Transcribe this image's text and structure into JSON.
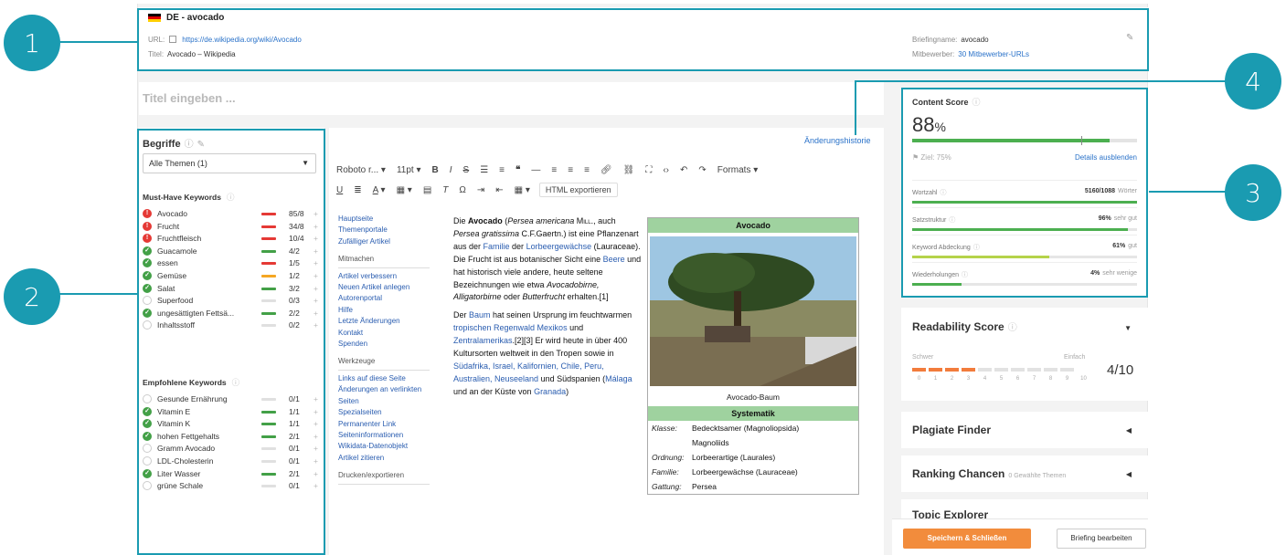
{
  "callouts": [
    "1",
    "2",
    "3",
    "4"
  ],
  "header": {
    "title": "DE - avocado",
    "url_label": "URL:",
    "url": "https://de.wikipedia.org/wiki/Avocado",
    "title_label": "Titel:",
    "page_title": "Avocado – Wikipedia",
    "briefing_label": "Briefingname:",
    "briefing_name": "avocado",
    "competitor_label": "Mitbewerber:",
    "competitor_link": "30 Mitbewerber-URLs"
  },
  "title_placeholder": "Titel eingeben ...",
  "begriffe": {
    "title": "Begriffe",
    "select_value": "Alle Themen (1)",
    "must_have_label": "Must-Have Keywords",
    "must_have": [
      {
        "name": "Avocado",
        "count": "85/8",
        "status": "red",
        "bar": "#e53935"
      },
      {
        "name": "Frucht",
        "count": "34/8",
        "status": "red",
        "bar": "#e53935"
      },
      {
        "name": "Fruchtfleisch",
        "count": "10/4",
        "status": "red",
        "bar": "#e53935"
      },
      {
        "name": "Guacamole",
        "count": "4/2",
        "status": "green",
        "bar": "#43a047"
      },
      {
        "name": "essen",
        "count": "1/5",
        "status": "green",
        "bar": "#e53935"
      },
      {
        "name": "Gemüse",
        "count": "1/2",
        "status": "green",
        "bar": "#f5a623"
      },
      {
        "name": "Salat",
        "count": "3/2",
        "status": "green",
        "bar": "#43a047"
      },
      {
        "name": "Superfood",
        "count": "0/3",
        "status": "grey",
        "bar": "#e0e0e0"
      },
      {
        "name": "ungesättigten Fettsä...",
        "count": "2/2",
        "status": "green",
        "bar": "#43a047"
      },
      {
        "name": "Inhaltsstoff",
        "count": "0/2",
        "status": "grey",
        "bar": "#e0e0e0"
      }
    ],
    "recommended_label": "Empfohlene Keywords",
    "recommended": [
      {
        "name": "Gesunde Ernährung",
        "count": "0/1",
        "status": "grey",
        "bar": "#e0e0e0"
      },
      {
        "name": "Vitamin E",
        "count": "1/1",
        "status": "green",
        "bar": "#43a047"
      },
      {
        "name": "Vitamin K",
        "count": "1/1",
        "status": "green",
        "bar": "#43a047"
      },
      {
        "name": "hohen Fettgehalts",
        "count": "2/1",
        "status": "green",
        "bar": "#43a047"
      },
      {
        "name": "Gramm Avocado",
        "count": "0/1",
        "status": "grey",
        "bar": "#e0e0e0"
      },
      {
        "name": "LDL-Cholesterin",
        "count": "0/1",
        "status": "grey",
        "bar": "#e0e0e0"
      },
      {
        "name": "Liter Wasser",
        "count": "2/1",
        "status": "green",
        "bar": "#43a047"
      },
      {
        "name": "grüne Schale",
        "count": "0/1",
        "status": "grey",
        "bar": "#e0e0e0"
      }
    ]
  },
  "editor": {
    "history_link": "Änderungshistorie",
    "font": "Roboto r...",
    "size": "11pt",
    "formats": "Formats",
    "html_export": "HTML exportieren"
  },
  "wiki_nav": {
    "main": [
      "Hauptseite",
      "Themenportale",
      "Zufälliger Artikel"
    ],
    "mitmachen_h": "Mitmachen",
    "mitmachen": [
      "Artikel verbessern",
      "Neuen Artikel anlegen",
      "Autorenportal",
      "Hilfe",
      "Letzte Änderungen",
      "Kontakt",
      "Spenden"
    ],
    "werkzeuge_h": "Werkzeuge",
    "werkzeuge": [
      "Links auf diese Seite",
      "Änderungen an verlinkten Seiten",
      "Spezialseiten",
      "Permanenter Link",
      "Seiteninformationen",
      "Wikidata-Datenobjekt",
      "Artikel zitieren"
    ],
    "drucken_h": "Drucken/exportieren"
  },
  "wiki_body": {
    "p1_a": "Die ",
    "p1_b": "Avocado",
    "p1_c": " (",
    "p1_d": "Persea americana",
    "p1_e": " Mill.,",
    "p1_f": " auch ",
    "p1_g": "Persea gratissima",
    "p1_h": " C.F.Gaertn.) ist eine Pflanzenart aus der ",
    "p1_i": "Familie",
    "p1_j": " der ",
    "p1_k": "Lorbeergewächse",
    "p1_l": " (Lauraceae). Die Frucht ist aus botanischer Sicht eine ",
    "p1_m": "Beere",
    "p1_n": " und hat historisch viele andere, heute seltene Bezeichnungen wie etwa ",
    "p1_o": "Avocadobirne, Alligatorbirne",
    "p1_p": " oder ",
    "p1_q": "Butterfrucht",
    "p1_r": " erhalten.[1]",
    "p2_a": "Der ",
    "p2_b": "Baum",
    "p2_c": " hat seinen Ursprung im feuchtwarmen ",
    "p2_d": "tropischen Regenwald Mexikos",
    "p2_e": " und ",
    "p2_f": "Zentralamerikas",
    "p2_g": ".[2][3] Er wird heute in über 400 Kultursorten weltweit in den Tropen sowie in ",
    "p2_h": "Südafrika, Israel, Kalifornien, Chile, Peru, Australien, Neuseeland",
    "p2_i": " und Südspanien (",
    "p2_j": "Málaga",
    "p2_k": " und an der Küste von ",
    "p2_l": "Granada",
    "p2_m": ")"
  },
  "infobox": {
    "title": "Avocado",
    "caption": "Avocado-Baum",
    "sys_title": "Systematik",
    "rows": [
      {
        "k": "Klasse:",
        "v": "Bedecktsamer (Magnoliopsida)"
      },
      {
        "k": "",
        "v": "Magnoliids"
      },
      {
        "k": "Ordnung:",
        "v": "Lorbeerartige (Laurales)"
      },
      {
        "k": "Familie:",
        "v": "Lorbeergewächse (Lauraceae)"
      },
      {
        "k": "Gattung:",
        "v": "Persea"
      }
    ]
  },
  "content_score": {
    "title": "Content Score",
    "value": "88",
    "unit": "%",
    "fill": 0.88,
    "goal_fraction": 0.75,
    "goal": "Ziel: 75%",
    "details": "Details ausblenden",
    "metrics": [
      {
        "label": "Wortzahl",
        "value": "5160/1088",
        "note": "Wörter",
        "fill": 1.0,
        "color": "#4caf50"
      },
      {
        "label": "Satzstruktur",
        "value": "96%",
        "note": "sehr gut",
        "fill": 0.96,
        "color": "#4caf50"
      },
      {
        "label": "Keyword Abdeckung",
        "value": "61%",
        "note": "gut",
        "fill": 0.61,
        "color": "#b5d34a"
      },
      {
        "label": "Wiederholungen",
        "value": "4%",
        "note": "sehr wenige",
        "fill": 0.22,
        "color": "#4caf50"
      }
    ]
  },
  "readability": {
    "title": "Readability Score",
    "hard": "Schwer",
    "easy": "Einfach",
    "level": 4,
    "value": "4/10",
    "scale": [
      "0",
      "1",
      "2",
      "3",
      "4",
      "5",
      "6",
      "7",
      "8",
      "9",
      "10"
    ]
  },
  "plagiate": {
    "title": "Plagiate Finder"
  },
  "ranking": {
    "title": "Ranking Chancen",
    "sub": "0 Gewählte Themen"
  },
  "topic": {
    "title": "Topic Explorer"
  },
  "footer": {
    "save": "Speichern & Schließen",
    "edit": "Briefing bearbeiten"
  },
  "colors": {
    "accent": "#1a9bb1",
    "save": "#f28c3c",
    "link": "#2a72c9",
    "good": "#4caf50",
    "bad": "#e53935"
  }
}
